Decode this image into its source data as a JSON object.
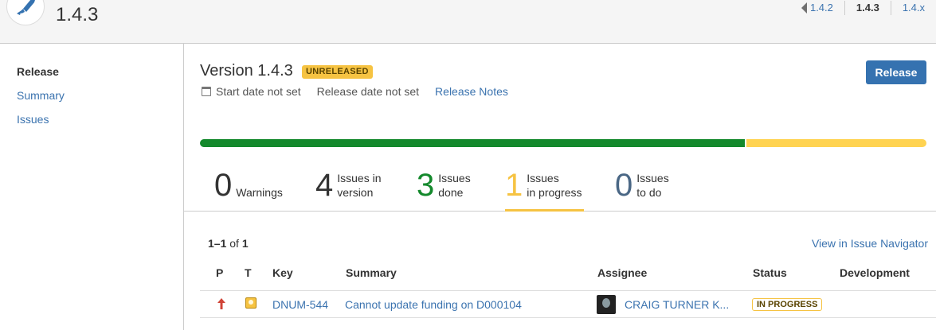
{
  "header": {
    "version_title": "1.4.3",
    "version_nav": {
      "prev": "1.4.2",
      "current": "1.4.3",
      "next": "1.4.x"
    }
  },
  "sidebar": {
    "items": [
      {
        "label": "Release"
      },
      {
        "label": "Summary"
      },
      {
        "label": "Issues"
      }
    ]
  },
  "version": {
    "title": "Version 1.4.3",
    "badge": "UNRELEASED",
    "start_date": "Start date not set",
    "release_date": "Release date not set",
    "release_notes": "Release Notes",
    "release_button": "Release",
    "progress": {
      "done_fraction": 0.75,
      "in_progress_fraction": 0.25
    }
  },
  "stats": {
    "warnings": {
      "count": "0",
      "label": "Warnings"
    },
    "total": {
      "count": "4",
      "label": "Issues in\nversion"
    },
    "done": {
      "count": "3",
      "label": "Issues\ndone"
    },
    "in_progress": {
      "count": "1",
      "label": "Issues\nin progress"
    },
    "todo": {
      "count": "0",
      "label": "Issues\nto do"
    }
  },
  "issues": {
    "range": "1–1",
    "of": "of",
    "total": "1",
    "navigator_link": "View in Issue Navigator",
    "columns": {
      "p": "P",
      "t": "T",
      "key": "Key",
      "summary": "Summary",
      "assignee": "Assignee",
      "status": "Status",
      "development": "Development"
    },
    "rows": [
      {
        "key": "DNUM-544",
        "summary": "Cannot update funding on D000104",
        "assignee": "CRAIG TURNER K...",
        "status": "IN PROGRESS",
        "priority_icon": "arrow-up-icon",
        "type_icon": "improvement-icon"
      }
    ]
  },
  "colors": {
    "accent": "#3572b0",
    "done": "#14892c",
    "in_progress": "#f6c342",
    "todo": "#4a6785"
  }
}
